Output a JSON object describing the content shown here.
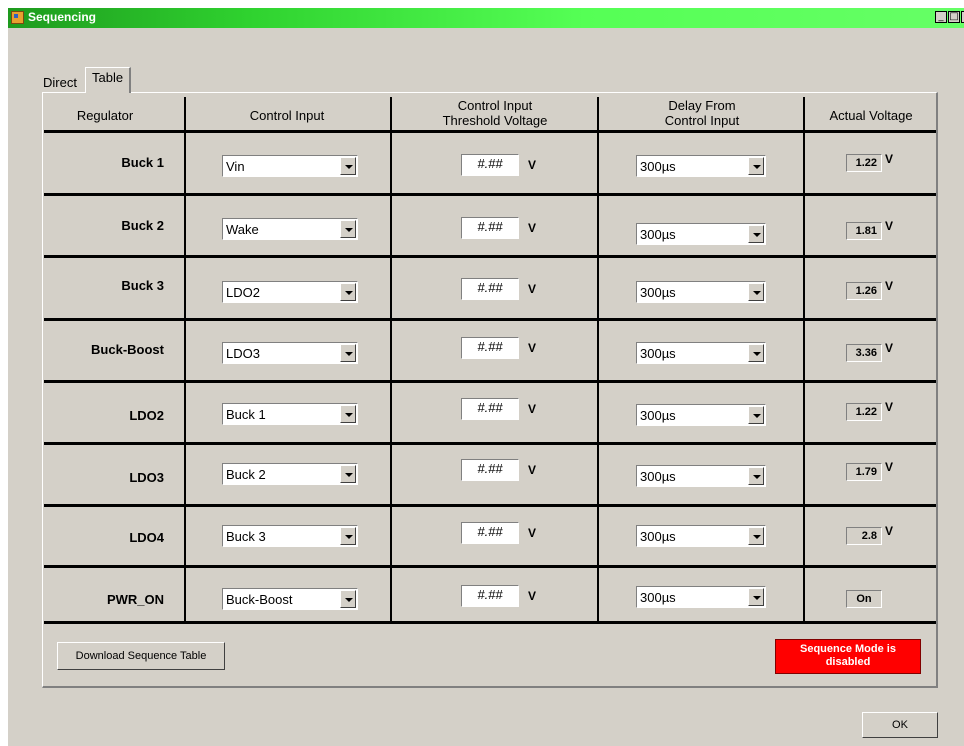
{
  "window": {
    "title": "Sequencing"
  },
  "tabs": [
    "Direct",
    "Table"
  ],
  "headers": {
    "regulator": "Regulator",
    "control_input": "Control Input",
    "threshold_l1": "Control Input",
    "threshold_l2": "Threshold Voltage",
    "delay_l1": "Delay From",
    "delay_l2": "Control Input",
    "actual": "Actual Voltage"
  },
  "unit": "V",
  "rows": [
    {
      "name": "Buck 1",
      "control": "Vin",
      "threshold": "#.##",
      "delay": "300µs",
      "actual": "1.22",
      "actual_unit": "V"
    },
    {
      "name": "Buck 2",
      "control": "Wake",
      "threshold": "#.##",
      "delay": "300µs",
      "actual": "1.81",
      "actual_unit": "V"
    },
    {
      "name": "Buck 3",
      "control": "LDO2",
      "threshold": "#.##",
      "delay": "300µs",
      "actual": "1.26",
      "actual_unit": "V"
    },
    {
      "name": "Buck-Boost",
      "control": "LDO3",
      "threshold": "#.##",
      "delay": "300µs",
      "actual": "3.36",
      "actual_unit": "V"
    },
    {
      "name": "LDO2",
      "control": "Buck 1",
      "threshold": "#.##",
      "delay": "300µs",
      "actual": "1.22",
      "actual_unit": "V"
    },
    {
      "name": "LDO3",
      "control": "Buck 2",
      "threshold": "#.##",
      "delay": "300µs",
      "actual": "1.79",
      "actual_unit": "V"
    },
    {
      "name": "LDO4",
      "control": "Buck 3",
      "threshold": "#.##",
      "delay": "300µs",
      "actual": "2.8",
      "actual_unit": "V"
    },
    {
      "name": "PWR_ON",
      "control": "Buck-Boost",
      "threshold": "#.##",
      "delay": "300µs",
      "actual": "On",
      "actual_unit": ""
    }
  ],
  "buttons": {
    "download": "Download Sequence Table",
    "ok": "OK"
  },
  "status": {
    "line1": "Sequence Mode is",
    "line2": "disabled",
    "color": "#ff0000"
  }
}
